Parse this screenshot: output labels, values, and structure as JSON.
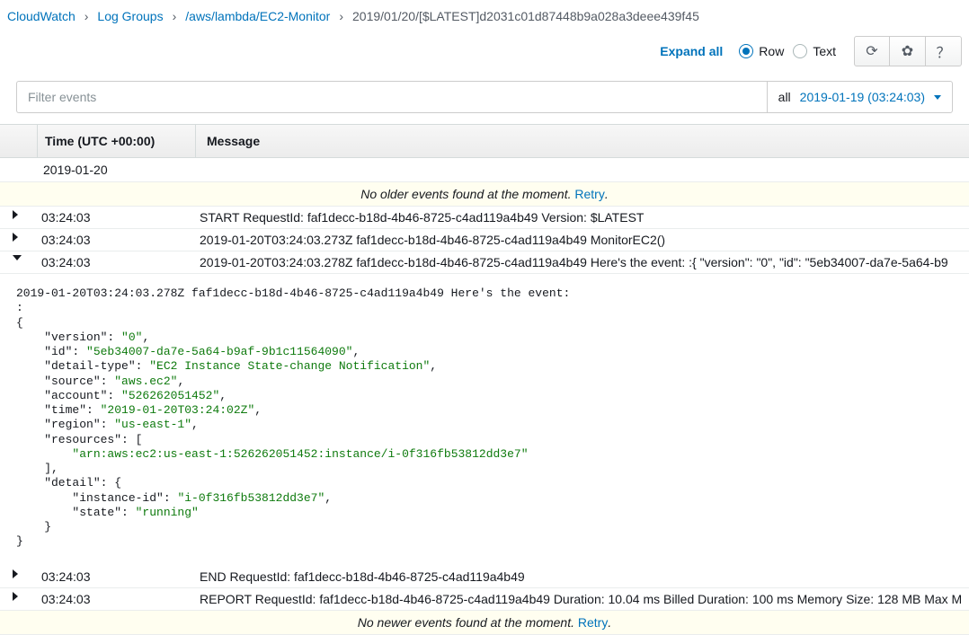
{
  "breadcrumb": {
    "items": [
      "CloudWatch",
      "Log Groups",
      "/aws/lambda/EC2-Monitor"
    ],
    "current": "2019/01/20/[$LATEST]d2031c01d87448b9a028a3deee439f45"
  },
  "toolbar": {
    "expand_all": "Expand all",
    "view_row": "Row",
    "view_text": "Text"
  },
  "filter": {
    "placeholder": "Filter events",
    "scope": "all",
    "date": "2019-01-19 (03:24:03)"
  },
  "table": {
    "headers": {
      "time": "Time (UTC +00:00)",
      "message": "Message"
    },
    "date_group": "2019-01-20",
    "no_older": "No older events found at the moment. ",
    "no_newer": "No newer events found at the moment. ",
    "retry": "Retry",
    "rows": [
      {
        "time": "03:24:03",
        "msg": "START RequestId: faf1decc-b18d-4b46-8725-c4ad119a4b49 Version: $LATEST",
        "expanded": false
      },
      {
        "time": "03:24:03",
        "msg": "2019-01-20T03:24:03.273Z faf1decc-b18d-4b46-8725-c4ad119a4b49 MonitorEC2()",
        "expanded": false
      },
      {
        "time": "03:24:03",
        "msg": "2019-01-20T03:24:03.278Z faf1decc-b18d-4b46-8725-c4ad119a4b49 Here's the event: :{  \"version\": \"0\",  \"id\": \"5eb34007-da7e-5a64-b9",
        "expanded": true
      },
      {
        "time": "03:24:03",
        "msg": "END RequestId: faf1decc-b18d-4b46-8725-c4ad119a4b49",
        "expanded": false
      },
      {
        "time": "03:24:03",
        "msg": "REPORT RequestId: faf1decc-b18d-4b46-8725-c4ad119a4b49 Duration: 10.04 ms Billed Duration: 100 ms Memory Size: 128 MB Max M",
        "expanded": false
      }
    ]
  },
  "expanded": {
    "prefix": "2019-01-20T03:24:03.278Z faf1decc-b18d-4b46-8725-c4ad119a4b49 Here's the event:",
    "json": {
      "version": "0",
      "id": "5eb34007-da7e-5a64-b9af-9b1c11564090",
      "detail-type": "EC2 Instance State-change Notification",
      "source": "aws.ec2",
      "account": "526262051452",
      "time": "2019-01-20T03:24:02Z",
      "region": "us-east-1",
      "resources": [
        "arn:aws:ec2:us-east-1:526262051452:instance/i-0f316fb53812dd3e7"
      ],
      "detail": {
        "instance-id": "i-0f316fb53812dd3e7",
        "state": "running"
      }
    }
  }
}
